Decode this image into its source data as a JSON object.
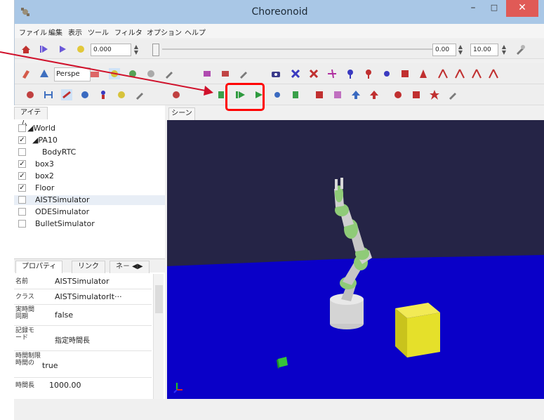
{
  "window": {
    "title": "Choreonoid"
  },
  "menubar": {
    "items": [
      "ファイル",
      "編集",
      "表示",
      "ツール",
      "フィルタ",
      "オプション",
      "ヘルプ"
    ]
  },
  "time_bar": {
    "current_time": "0.000",
    "range_start": "0.00",
    "range_end": "10.00"
  },
  "view_toolbar": {
    "camera_mode": "Perspe"
  },
  "panels": {
    "items_tab": "アイテム",
    "scene_tab": "シーン"
  },
  "item_tree": [
    {
      "label": "World",
      "checked": false,
      "level": 0
    },
    {
      "label": "PA10",
      "checked": true,
      "level": 1
    },
    {
      "label": "BodyRTC",
      "checked": false,
      "level": 2
    },
    {
      "label": "box3",
      "checked": true,
      "level": 1
    },
    {
      "label": "box2",
      "checked": true,
      "level": 1
    },
    {
      "label": "Floor",
      "checked": true,
      "level": 1
    },
    {
      "label": "AISTSimulator",
      "checked": false,
      "level": 1,
      "selected": true
    },
    {
      "label": "ODESimulator",
      "checked": false,
      "level": 1
    },
    {
      "label": "BulletSimulator",
      "checked": false,
      "level": 1
    }
  ],
  "property_tabs": [
    "プロパティ",
    "リンク",
    "ネ－"
  ],
  "properties": [
    {
      "key": "名前",
      "value": "AISTSimulator"
    },
    {
      "key": "クラス",
      "value": "AISTSimulatorIt···"
    },
    {
      "key": "実時間同期",
      "value": "false"
    },
    {
      "key": "記録モード",
      "value": "指定時間長"
    },
    {
      "key": "時間制限時間の",
      "value": "true"
    },
    {
      "key": "時間長",
      "value": "1000.00"
    }
  ],
  "colors": {
    "titlebar": "#a9c7e6",
    "close_button": "#e05a56",
    "scene_sky": "#252446",
    "scene_floor": "#0a00c8",
    "highlight": "#ff0000",
    "arrow": "#d0112b",
    "robot_joint": "#8fcb78",
    "box": "#e5e02a"
  },
  "icons": {
    "simulation_start": "sim-start-icon",
    "simulation_restart": "sim-restart-icon"
  }
}
